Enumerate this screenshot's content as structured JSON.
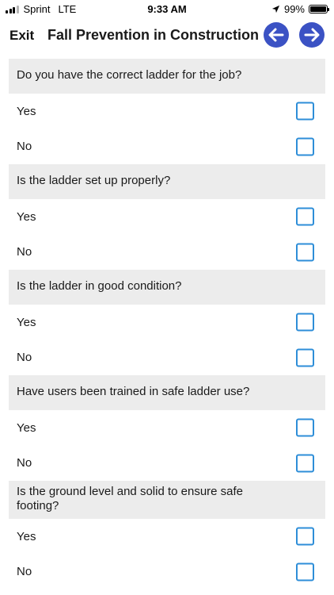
{
  "status_bar": {
    "carrier": "Sprint",
    "network": "LTE",
    "time": "9:33 AM",
    "battery": "99%",
    "battery_level": 0.99
  },
  "nav": {
    "exit_label": "Exit",
    "title": "Fall Prevention in Construction",
    "prev_icon": "arrow-left-icon",
    "next_icon": "arrow-right-icon",
    "accent_color": "#3b52c4"
  },
  "questions": [
    {
      "text": "Do you have the correct ladder for the job?",
      "options": [
        "Yes",
        "No"
      ]
    },
    {
      "text": "Is the ladder set up properly?",
      "options": [
        "Yes",
        "No"
      ]
    },
    {
      "text": "Is the ladder in good condition?",
      "options": [
        "Yes",
        "No"
      ]
    },
    {
      "text": "Have users been trained in safe ladder use?",
      "options": [
        "Yes",
        "No"
      ]
    },
    {
      "text": "Is the ground level and solid to ensure safe footing?",
      "options": [
        "Yes",
        "No"
      ]
    }
  ],
  "checkbox_color": "#2e8ed8"
}
